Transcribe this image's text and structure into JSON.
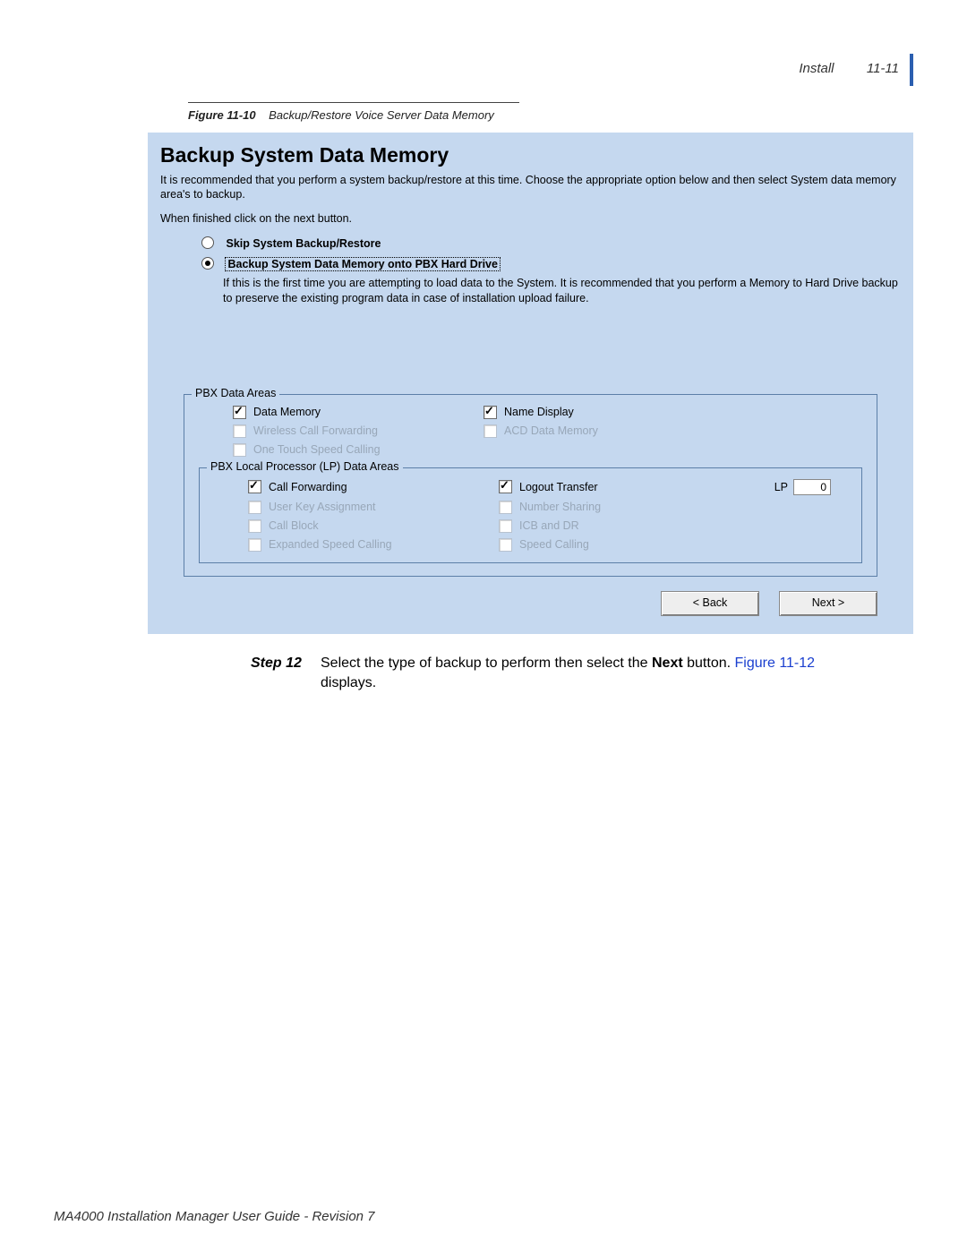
{
  "header": {
    "section": "Install",
    "page": "11-11"
  },
  "caption": {
    "label": "Figure 11-10",
    "title": "Backup/Restore Voice Server Data Memory"
  },
  "panel": {
    "title": "Backup System Data Memory",
    "intro": "It is recommended that you perform a system backup/restore at this time.  Choose the appropriate option below and then select System data memory area's to backup.",
    "hint": "When finished click on the next button.",
    "radios": {
      "skip": "Skip System Backup/Restore",
      "backup": "Backup System Data Memory onto PBX Hard Drive"
    },
    "backup_desc": "If this is the first time you are attempting to load data to the System. It is recommended that you perform a Memory to Hard Drive backup to preserve the existing program data in case of installation upload failure.",
    "group1_legend": "PBX Data Areas",
    "group2_legend": "PBX Local Processor (LP) Data Areas",
    "g1": {
      "data_memory": "Data Memory",
      "name_display": "Name Display",
      "wireless": "Wireless Call Forwarding",
      "acd": "ACD Data Memory",
      "onetouch": "One Touch Speed Calling"
    },
    "g2": {
      "call_fwd": "Call Forwarding",
      "logout": "Logout Transfer",
      "userkey": "User Key Assignment",
      "number_sharing": "Number Sharing",
      "callblock": "Call Block",
      "icb": "ICB and DR",
      "exp_speed": "Expanded Speed Calling",
      "speed": "Speed Calling",
      "lp_label": "LP",
      "lp_value": "0"
    },
    "buttons": {
      "back": "< Back",
      "next": "Next >"
    }
  },
  "step": {
    "label": "Step  12",
    "text_1": "Select the type of backup to perform then select the ",
    "bold": "Next",
    "text_2": " button. ",
    "link": "Figure 11-12",
    "text_3": " displays."
  },
  "footer": "MA4000 Installation Manager User Guide - Revision 7"
}
